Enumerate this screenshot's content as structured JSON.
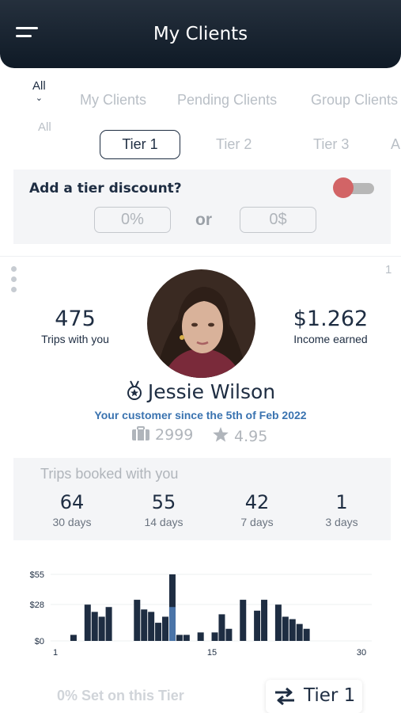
{
  "header": {
    "title": "My Clients"
  },
  "filters": {
    "dropdown_label": "All",
    "dropdown_sub": "All",
    "categories": [
      "My Clients",
      "Pending Clients",
      "Group Clients"
    ],
    "tiers": [
      "Tier 1",
      "Tier 2",
      "Tier 3",
      "A"
    ],
    "active_tier": "Tier 1"
  },
  "discount": {
    "label": "Add a tier discount?",
    "toggle_on": false,
    "percent_placeholder": "0%",
    "or_text": "or",
    "amount_placeholder": "0$"
  },
  "client": {
    "index": "1",
    "trips_value": "475",
    "trips_label": "Trips with you",
    "income_value": "$1.262",
    "income_label": "Income earned",
    "name": "Jessie Wilson",
    "since": "Your customer since the 5th of Feb 2022",
    "bookings": "2999",
    "rating": "4.95"
  },
  "trips_panel": {
    "title": "Trips booked with you",
    "stats": [
      {
        "value": "64",
        "label": "30 days"
      },
      {
        "value": "55",
        "label": "14 days"
      },
      {
        "value": "42",
        "label": "7 days"
      },
      {
        "value": "1",
        "label": "3 days"
      }
    ]
  },
  "footer": {
    "note": "0% Set on this Tier",
    "tier_button": "Tier 1"
  },
  "colors": {
    "header_bg": "#1b2633",
    "primary": "#1e2d42",
    "accent_blue": "#3a73b0",
    "toggle_knob": "#d26466",
    "bar_highlight": "#4a74a8"
  },
  "chart_data": {
    "type": "bar",
    "ylabels": [
      "$55",
      "$28",
      "$0"
    ],
    "xlabels": [
      "1",
      "15",
      "30"
    ],
    "ylim": [
      0,
      55
    ],
    "x": [
      0,
      1,
      2,
      3,
      4,
      5,
      6,
      7,
      8,
      9,
      10,
      11,
      12,
      13,
      14,
      15,
      16,
      17,
      18,
      19,
      20,
      21,
      22,
      23,
      24,
      25,
      26,
      27,
      28,
      29,
      30,
      31,
      32,
      33,
      34,
      35,
      36,
      37,
      38,
      39,
      40,
      41
    ],
    "values": [
      0,
      5,
      0,
      30,
      24,
      20,
      28,
      0,
      0,
      0,
      34,
      26,
      24,
      15,
      20,
      55,
      5,
      5,
      0,
      7,
      0,
      7,
      22,
      10,
      0,
      34,
      0,
      25,
      34,
      0,
      30,
      20,
      18,
      14,
      10
    ],
    "highlight": {
      "index": 15,
      "value": 28
    }
  }
}
